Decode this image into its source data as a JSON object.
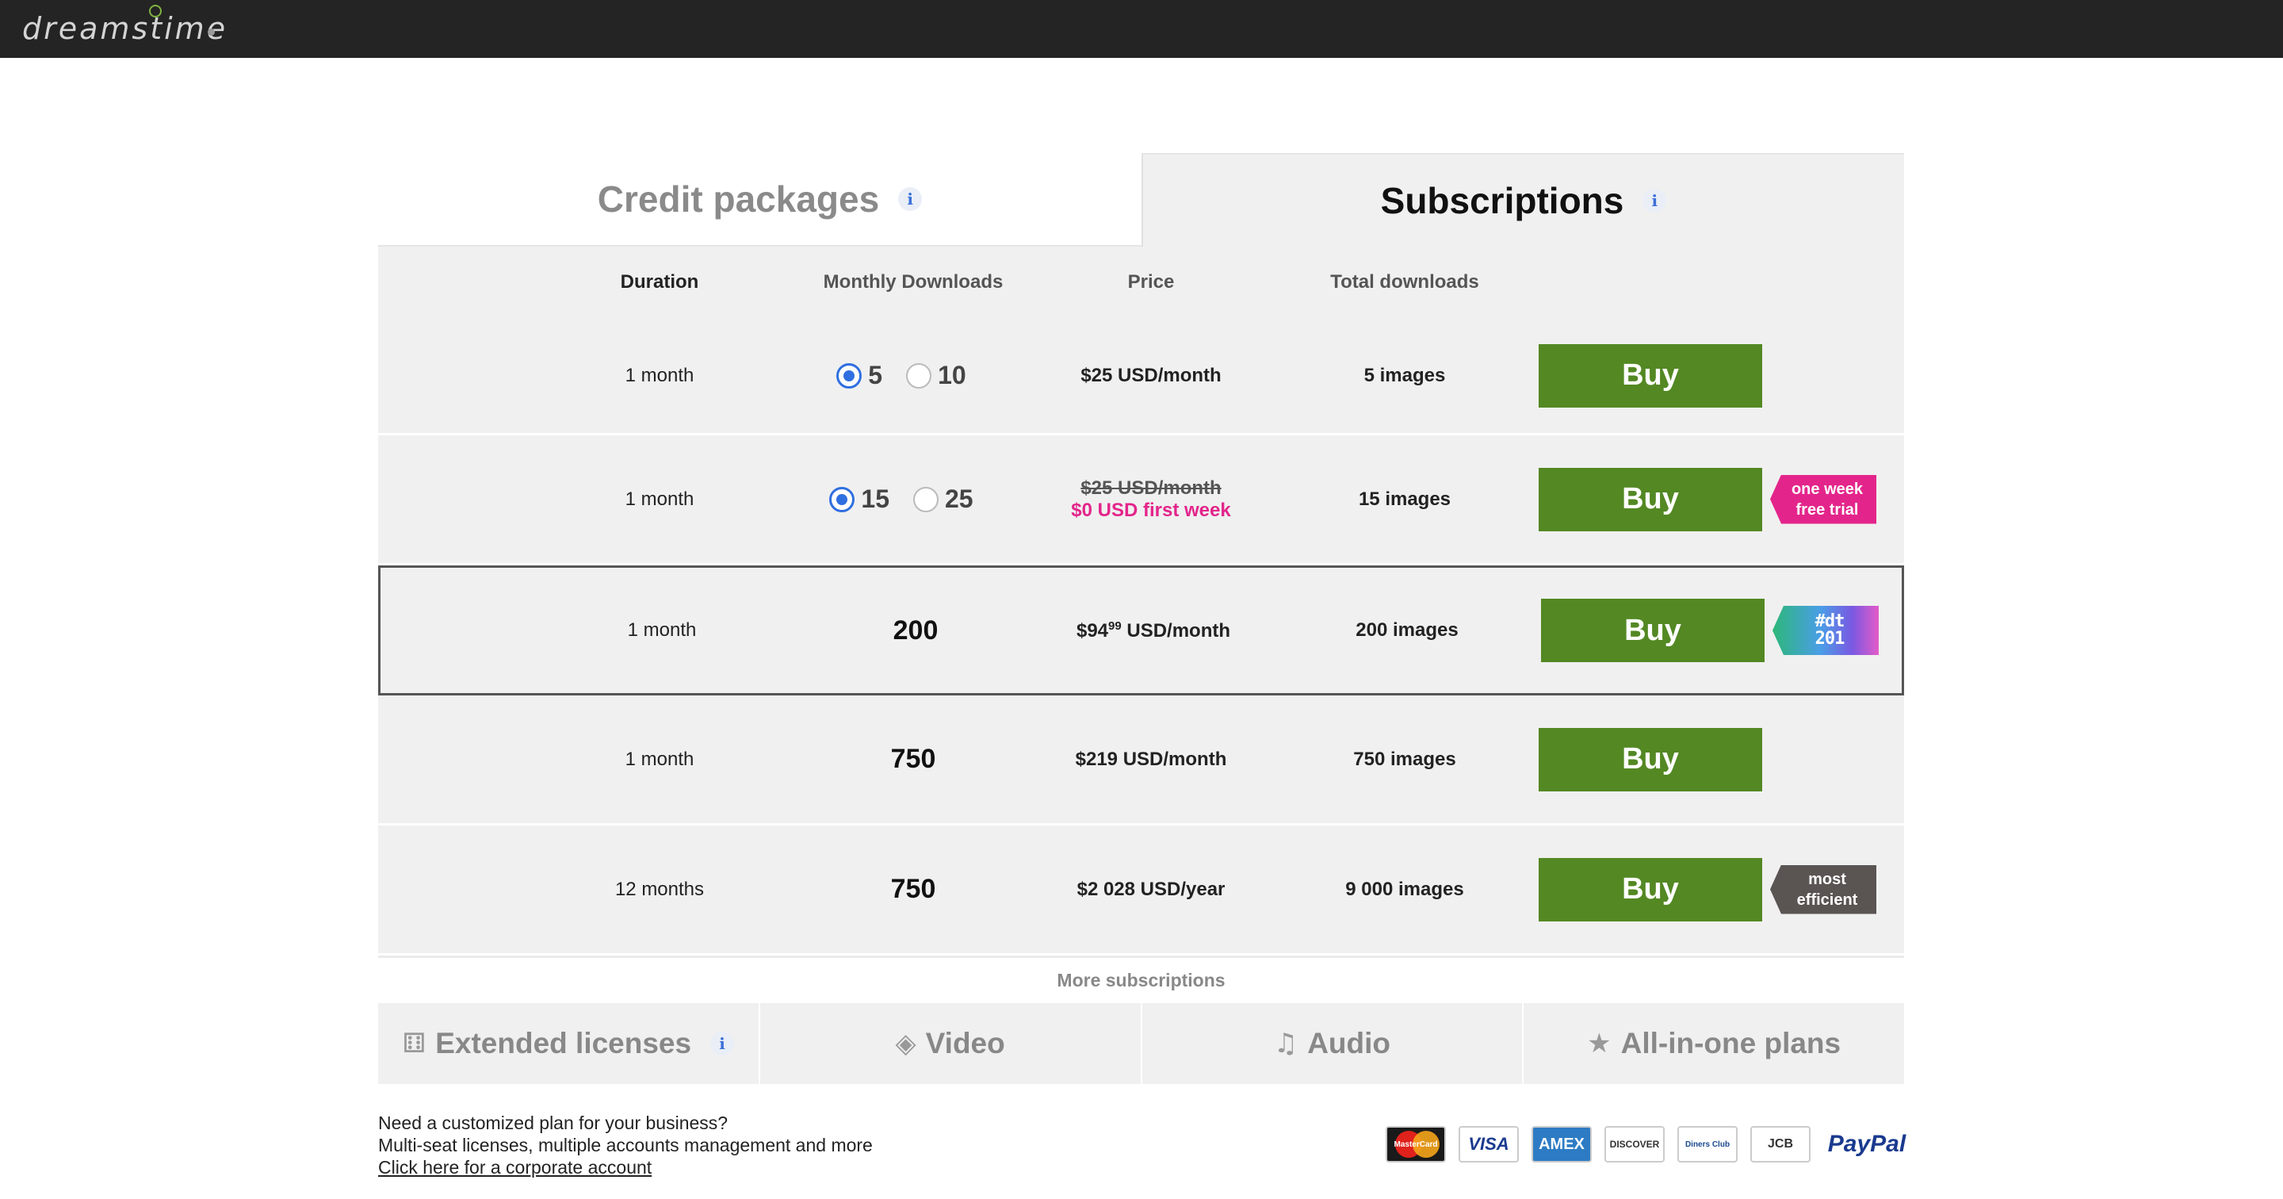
{
  "brand": {
    "logo_text": "dreamstime"
  },
  "tabs": {
    "credit": "Credit packages",
    "subscriptions": "Subscriptions",
    "info_glyph": "i"
  },
  "columns": {
    "duration": "Duration",
    "monthly": "Monthly Downloads",
    "price": "Price",
    "total": "Total downloads"
  },
  "rows": [
    {
      "duration": "1 month",
      "options": [
        "5",
        "10"
      ],
      "selected": "5",
      "price": "$25 USD/month",
      "total": "5 images",
      "buy": "Buy"
    },
    {
      "duration": "1 month",
      "options": [
        "15",
        "25"
      ],
      "selected": "15",
      "price_old": "$25 USD/month",
      "price_promo": "$0 USD first week",
      "total": "15 images",
      "buy": "Buy",
      "badge": [
        "one week",
        "free trial"
      ]
    },
    {
      "duration": "1 month",
      "monthly": "200",
      "price_main": "$94",
      "price_sup": "99",
      "price_unit": " USD/month",
      "total": "200 images",
      "buy": "Buy",
      "badge": [
        "#dt",
        "201"
      ]
    },
    {
      "duration": "1 month",
      "monthly": "750",
      "price": "$219 USD/month",
      "total": "750 images",
      "buy": "Buy"
    },
    {
      "duration": "12 months",
      "monthly": "750",
      "price": "$2 028 USD/year",
      "total": "9 000 images",
      "buy": "Buy",
      "badge": [
        "most",
        "efficient"
      ]
    }
  ],
  "more": {
    "title": "More subscriptions",
    "tabs": [
      "Extended licenses",
      "Video",
      "Audio",
      "All-in-one plans"
    ]
  },
  "footer": {
    "line1": "Need a customized plan for your business?",
    "line2": "Multi-seat licenses, multiple accounts management and more",
    "link": "Click here for a corporate account"
  },
  "payment_cards": {
    "mastercard": "MasterCard",
    "visa": "VISA",
    "amex": "AMEX",
    "discover": "DISCOVER",
    "diners": "Diners Club",
    "jcb": "JCB",
    "paypal": "PayPal"
  },
  "colors": {
    "buy_green": "#538823",
    "promo_pink": "#e3258b",
    "radio_blue": "#2f6fe0",
    "topbar": "#242424"
  }
}
